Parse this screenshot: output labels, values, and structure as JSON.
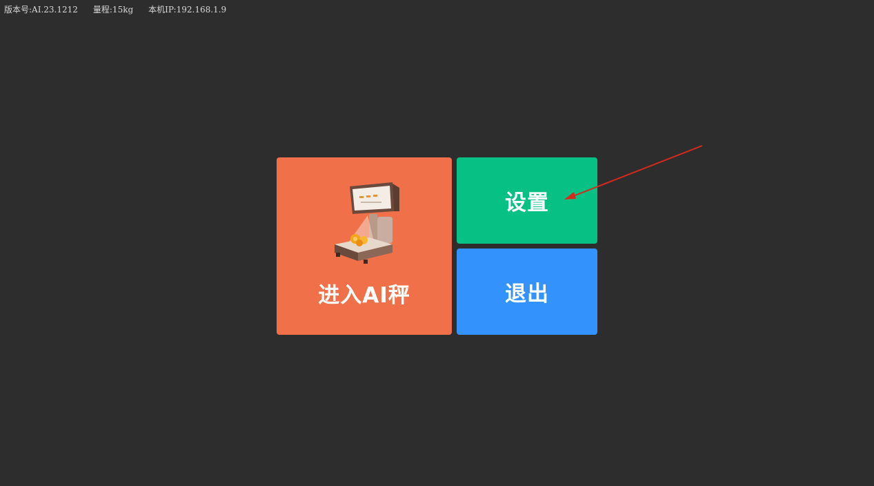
{
  "status": {
    "version": "版本号:AI.23.1212",
    "capacity": "量程:15kg",
    "ip": "本机IP:192.168.1.9"
  },
  "tiles": {
    "enter": {
      "label": "进入AI秤",
      "color": "#ef7049",
      "icon": "ai-scale-icon"
    },
    "settings": {
      "label": "设置",
      "color": "#07c084"
    },
    "exit": {
      "label": "退出",
      "color": "#3392fc"
    }
  },
  "annotation": {
    "color": "#d42a1e",
    "icon": "red-arrow-annotation"
  }
}
